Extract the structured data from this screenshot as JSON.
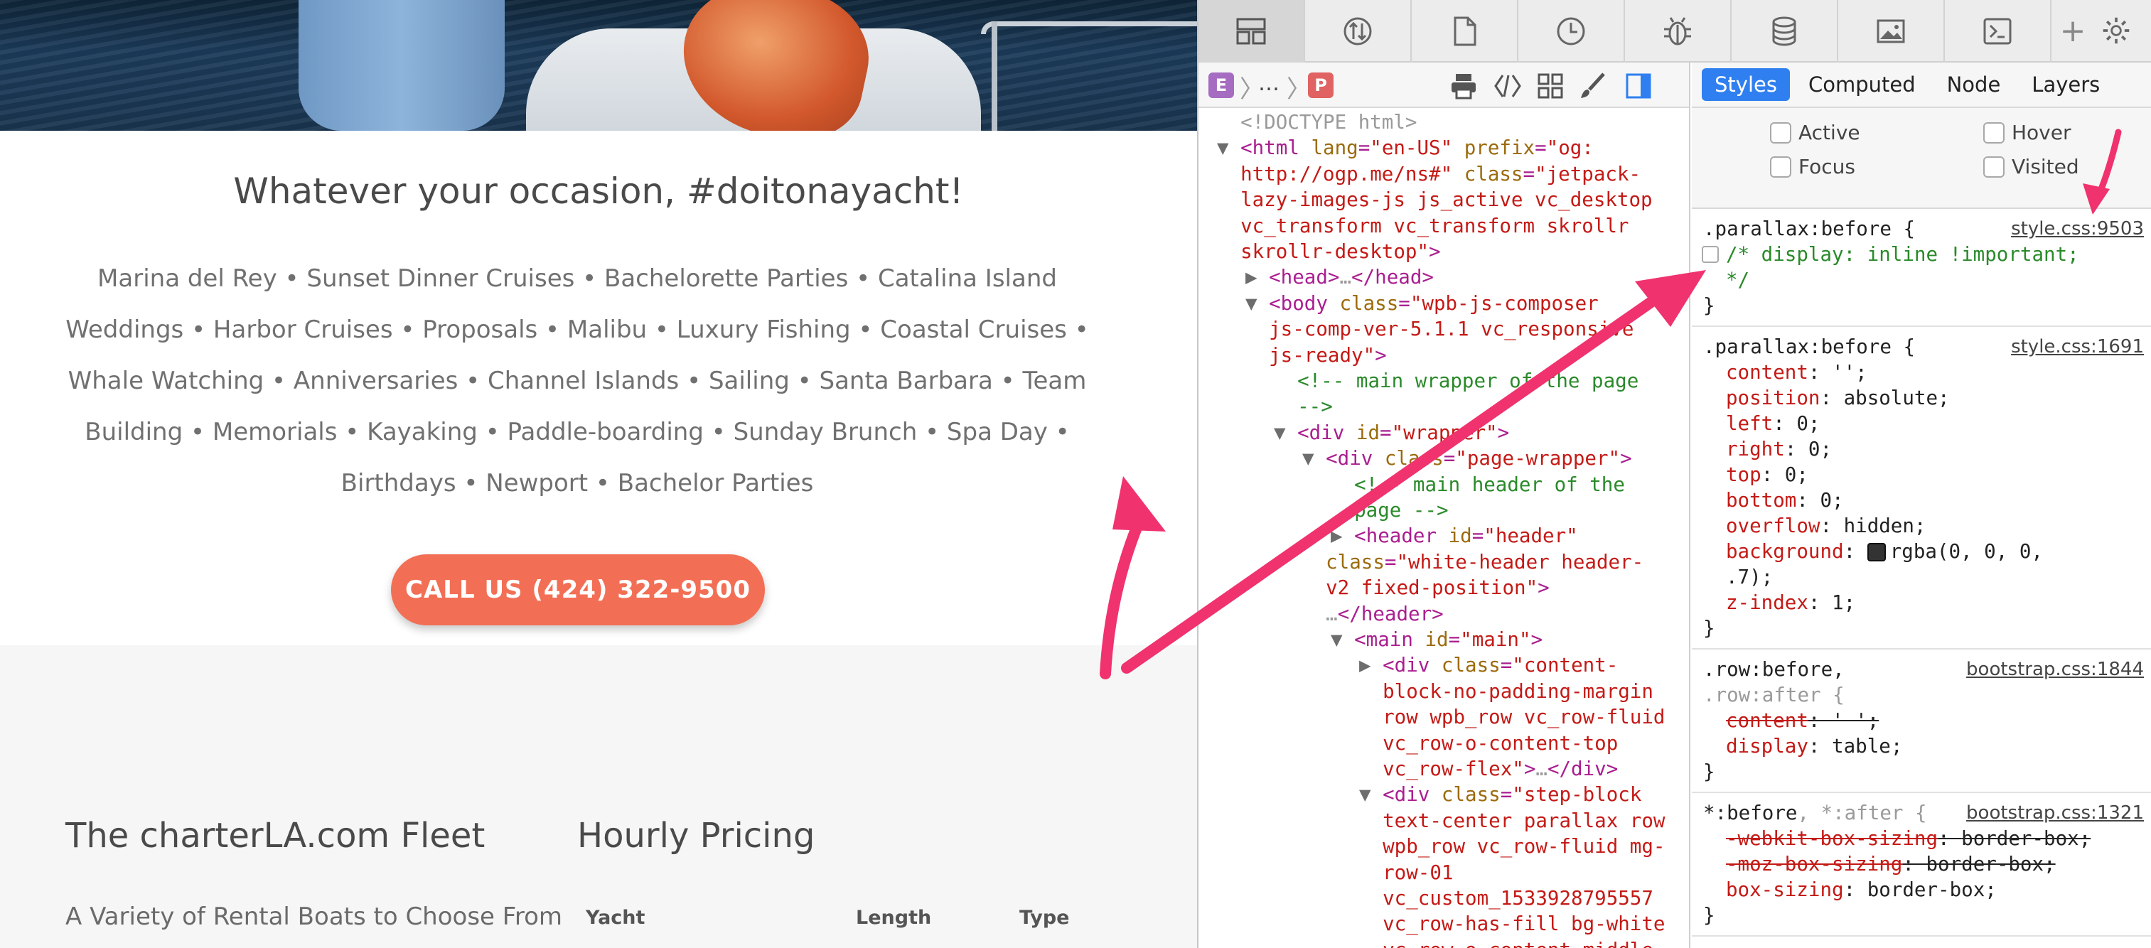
{
  "site": {
    "occasion_title": "Whatever your occasion, #doitonayacht!",
    "occasion_lines": [
      "Marina del Rey • Sunset Dinner Cruises • Bachelorette Parties • Catalina Island",
      "Weddings • Harbor Cruises • Proposals • Malibu • Luxury Fishing • Coastal Cruises •",
      "Whale Watching • Anniversaries • Channel Islands • Sailing • Santa Barbara • Team",
      "Building • Memorials • Kayaking • Paddle-boarding • Sunday Brunch • Spa Day •",
      "Birthdays • Newport • Bachelor Parties"
    ],
    "call_button": "CALL US (424) 322-9500",
    "fleet_title": "The charterLA.com Fleet",
    "fleet_subtitle": "A Variety of Rental Boats to Choose From",
    "pricing_title": "Hourly Pricing",
    "pricing_columns": [
      "Yacht",
      "Length",
      "Type"
    ],
    "accent_color": "#f26f55"
  },
  "devtools": {
    "tab_icons": [
      "elements-icon",
      "network-icon",
      "resources-icon",
      "timelines-icon",
      "debugger-icon",
      "storage-icon",
      "canvas-icon",
      "console-icon"
    ],
    "breadcrumb": {
      "badge_e": "E",
      "dots": "…",
      "badge_p": "P"
    },
    "dom_lines": [
      {
        "indent": 0,
        "tri": "",
        "parts": [
          [
            "gray",
            "<!DOCTYPE html>"
          ]
        ]
      },
      {
        "indent": 0,
        "tri": "▼",
        "parts": [
          [
            "tag",
            "<html "
          ],
          [
            "attr",
            "lang"
          ],
          [
            "tag",
            "="
          ],
          [
            "val",
            "\"en-US\""
          ],
          [
            "tag",
            " "
          ],
          [
            "attr",
            "prefix"
          ],
          [
            "tag",
            "="
          ],
          [
            "val",
            "\"og:"
          ]
        ]
      },
      {
        "indent": 0,
        "tri": "",
        "parts": [
          [
            "val",
            "http://ogp.me/ns#\""
          ],
          [
            "tag",
            " "
          ],
          [
            "attr",
            "class"
          ],
          [
            "tag",
            "="
          ],
          [
            "val",
            "\"jetpack-"
          ]
        ]
      },
      {
        "indent": 0,
        "tri": "",
        "parts": [
          [
            "val",
            "lazy-images-js js_active vc_desktop"
          ]
        ]
      },
      {
        "indent": 0,
        "tri": "",
        "parts": [
          [
            "val",
            "vc_transform vc_transform skrollr"
          ]
        ]
      },
      {
        "indent": 0,
        "tri": "",
        "parts": [
          [
            "val",
            "skrollr-desktop\""
          ],
          [
            "tag",
            ">"
          ]
        ]
      },
      {
        "indent": 1,
        "tri": "▶",
        "parts": [
          [
            "tag",
            "<head>"
          ],
          [
            "gray",
            "…"
          ],
          [
            "tag",
            "</head>"
          ]
        ]
      },
      {
        "indent": 1,
        "tri": "▼",
        "parts": [
          [
            "tag",
            "<body "
          ],
          [
            "attr",
            "class"
          ],
          [
            "tag",
            "="
          ],
          [
            "val",
            "\"wpb-js-composer"
          ]
        ]
      },
      {
        "indent": 1,
        "tri": "",
        "parts": [
          [
            "val",
            "js-comp-ver-5.1.1 vc_responsive"
          ]
        ]
      },
      {
        "indent": 1,
        "tri": "",
        "parts": [
          [
            "val",
            "js-ready\""
          ],
          [
            "tag",
            ">"
          ]
        ]
      },
      {
        "indent": 2,
        "tri": "",
        "parts": [
          [
            "cmt",
            "<!-- main wrapper of the page"
          ]
        ]
      },
      {
        "indent": 2,
        "tri": "",
        "parts": [
          [
            "cmt",
            "-->"
          ]
        ]
      },
      {
        "indent": 2,
        "tri": "▼",
        "parts": [
          [
            "tag",
            "<div "
          ],
          [
            "attr",
            "id"
          ],
          [
            "tag",
            "="
          ],
          [
            "val",
            "\"wrapper\""
          ],
          [
            "tag",
            ">"
          ]
        ]
      },
      {
        "indent": 3,
        "tri": "▼",
        "parts": [
          [
            "tag",
            "<div "
          ],
          [
            "attr",
            "class"
          ],
          [
            "tag",
            "="
          ],
          [
            "val",
            "\"page-wrapper\""
          ],
          [
            "tag",
            ">"
          ]
        ]
      },
      {
        "indent": 4,
        "tri": "",
        "parts": [
          [
            "cmt",
            "<!-- main header of the"
          ]
        ]
      },
      {
        "indent": 4,
        "tri": "",
        "parts": [
          [
            "cmt",
            "page -->"
          ]
        ]
      },
      {
        "indent": 4,
        "tri": "▶",
        "parts": [
          [
            "tag",
            "<header "
          ],
          [
            "attr",
            "id"
          ],
          [
            "tag",
            "="
          ],
          [
            "val",
            "\"header\""
          ]
        ]
      },
      {
        "indent": 3,
        "tri": "",
        "parts": [
          [
            "attr",
            "class"
          ],
          [
            "tag",
            "="
          ],
          [
            "val",
            "\"white-header header-"
          ]
        ]
      },
      {
        "indent": 3,
        "tri": "",
        "parts": [
          [
            "val",
            "v2 fixed-position\""
          ],
          [
            "tag",
            ">"
          ]
        ]
      },
      {
        "indent": 3,
        "tri": "",
        "parts": [
          [
            "gray",
            "…"
          ],
          [
            "tag",
            "</header>"
          ]
        ]
      },
      {
        "indent": 4,
        "tri": "▼",
        "parts": [
          [
            "tag",
            "<main "
          ],
          [
            "attr",
            "id"
          ],
          [
            "tag",
            "="
          ],
          [
            "val",
            "\"main\""
          ],
          [
            "tag",
            ">"
          ]
        ]
      },
      {
        "indent": 5,
        "tri": "▶",
        "parts": [
          [
            "tag",
            "<div "
          ],
          [
            "attr",
            "class"
          ],
          [
            "tag",
            "="
          ],
          [
            "val",
            "\"content-"
          ]
        ]
      },
      {
        "indent": 5,
        "tri": "",
        "parts": [
          [
            "val",
            "block-no-padding-margin"
          ]
        ]
      },
      {
        "indent": 5,
        "tri": "",
        "parts": [
          [
            "val",
            "row wpb_row vc_row-fluid"
          ]
        ]
      },
      {
        "indent": 5,
        "tri": "",
        "parts": [
          [
            "val",
            "vc_row-o-content-top"
          ]
        ]
      },
      {
        "indent": 5,
        "tri": "",
        "parts": [
          [
            "val",
            "vc_row-flex\""
          ],
          [
            "tag",
            ">"
          ],
          [
            "gray",
            "…"
          ],
          [
            "tag",
            "</div>"
          ]
        ]
      },
      {
        "indent": 5,
        "tri": "▼",
        "parts": [
          [
            "tag",
            "<div "
          ],
          [
            "attr",
            "class"
          ],
          [
            "tag",
            "="
          ],
          [
            "val",
            "\"step-block"
          ]
        ]
      },
      {
        "indent": 5,
        "tri": "",
        "parts": [
          [
            "val",
            "text-center parallax row"
          ]
        ]
      },
      {
        "indent": 5,
        "tri": "",
        "parts": [
          [
            "val",
            "wpb_row vc_row-fluid mg-"
          ]
        ]
      },
      {
        "indent": 5,
        "tri": "",
        "parts": [
          [
            "val",
            "row-01"
          ]
        ]
      },
      {
        "indent": 5,
        "tri": "",
        "parts": [
          [
            "val",
            "vc_custom_1533928795557"
          ]
        ]
      },
      {
        "indent": 5,
        "tri": "",
        "parts": [
          [
            "val",
            "vc_row-has-fill bg-white"
          ]
        ]
      },
      {
        "indent": 5,
        "tri": "",
        "parts": [
          [
            "val",
            "vc_row-o-content-middle"
          ]
        ]
      }
    ],
    "style_tabs": [
      "Styles",
      "Computed",
      "Node",
      "Layers"
    ],
    "pseudo_classes": [
      "Active",
      "Hover",
      "Focus",
      "Visited"
    ],
    "rules": [
      {
        "selector": ".parallax:before",
        "source": "style.css:9503",
        "lines": [
          [
            "comment",
            "/* display: inline !important;"
          ],
          [
            "comment",
            "*/"
          ]
        ]
      },
      {
        "selector": ".parallax:before",
        "source": "style.css:1691",
        "lines": [
          [
            "prop",
            "content",
            "'';"
          ],
          [
            "prop",
            "position",
            "absolute;"
          ],
          [
            "prop",
            "left",
            "0;"
          ],
          [
            "prop",
            "right",
            "0;"
          ],
          [
            "prop",
            "top",
            "0;"
          ],
          [
            "prop",
            "bottom",
            "0;"
          ],
          [
            "prop",
            "overflow",
            "hidden;"
          ],
          [
            "propcolor",
            "background",
            "rgba(0, 0, 0,"
          ],
          [
            "cont",
            "",
            ".7);"
          ],
          [
            "prop",
            "z-index",
            "1;"
          ]
        ]
      },
      {
        "selector": ".row:before",
        "selector2": ".row:after {",
        "source": "bootstrap.css:1844",
        "lines": [
          [
            "strike",
            "content",
            "' ';"
          ],
          [
            "prop",
            "display",
            "table;"
          ]
        ]
      },
      {
        "selector": "*:before",
        "selector_extra": ", *:after {",
        "source": "bootstrap.css:1321",
        "lines": [
          [
            "strike",
            "-webkit-box-sizing",
            "border-box;"
          ],
          [
            "strike",
            "-moz-box-sizing",
            "border-box;"
          ],
          [
            "prop",
            "box-sizing",
            "border-box;"
          ]
        ]
      }
    ],
    "highlight_color": "#2f7ff0"
  },
  "annotation_color": "#f0326e"
}
